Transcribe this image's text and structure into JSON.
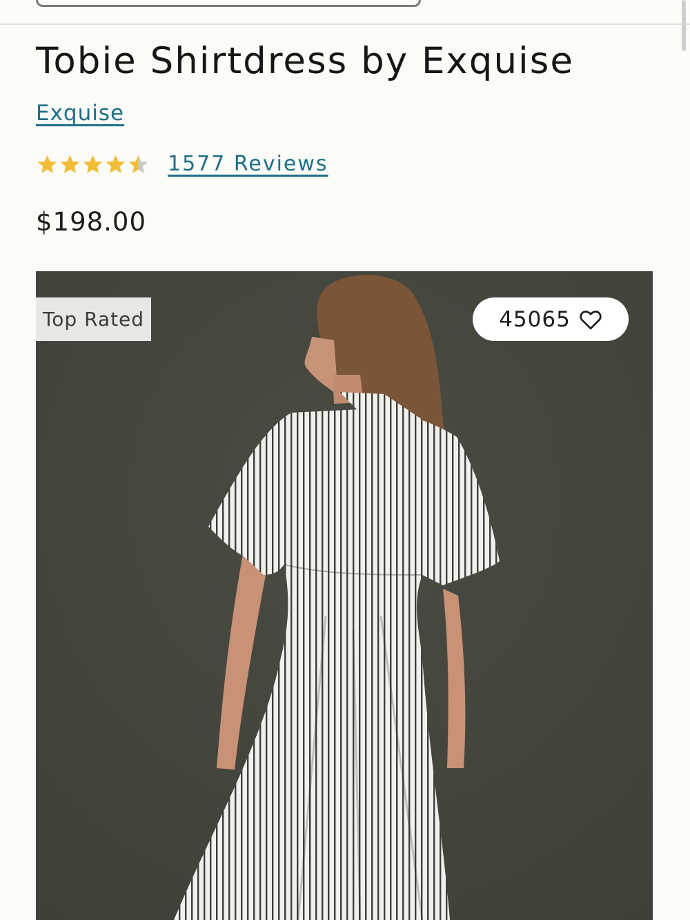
{
  "product": {
    "title": "Tobie Shirtdress by Exquise",
    "brand": "Exquise",
    "rating": 4.5,
    "rating_max": 5,
    "reviews_label": "1577 Reviews",
    "price": "$198.00"
  },
  "image": {
    "badge": "Top Rated",
    "favorites_count": "45065",
    "favorite_icon": "heart-outline-icon"
  },
  "colors": {
    "link": "#1e6f8a",
    "star": "#f2bd36",
    "star_empty": "#c9c9c9",
    "image_background": "#45473f"
  }
}
